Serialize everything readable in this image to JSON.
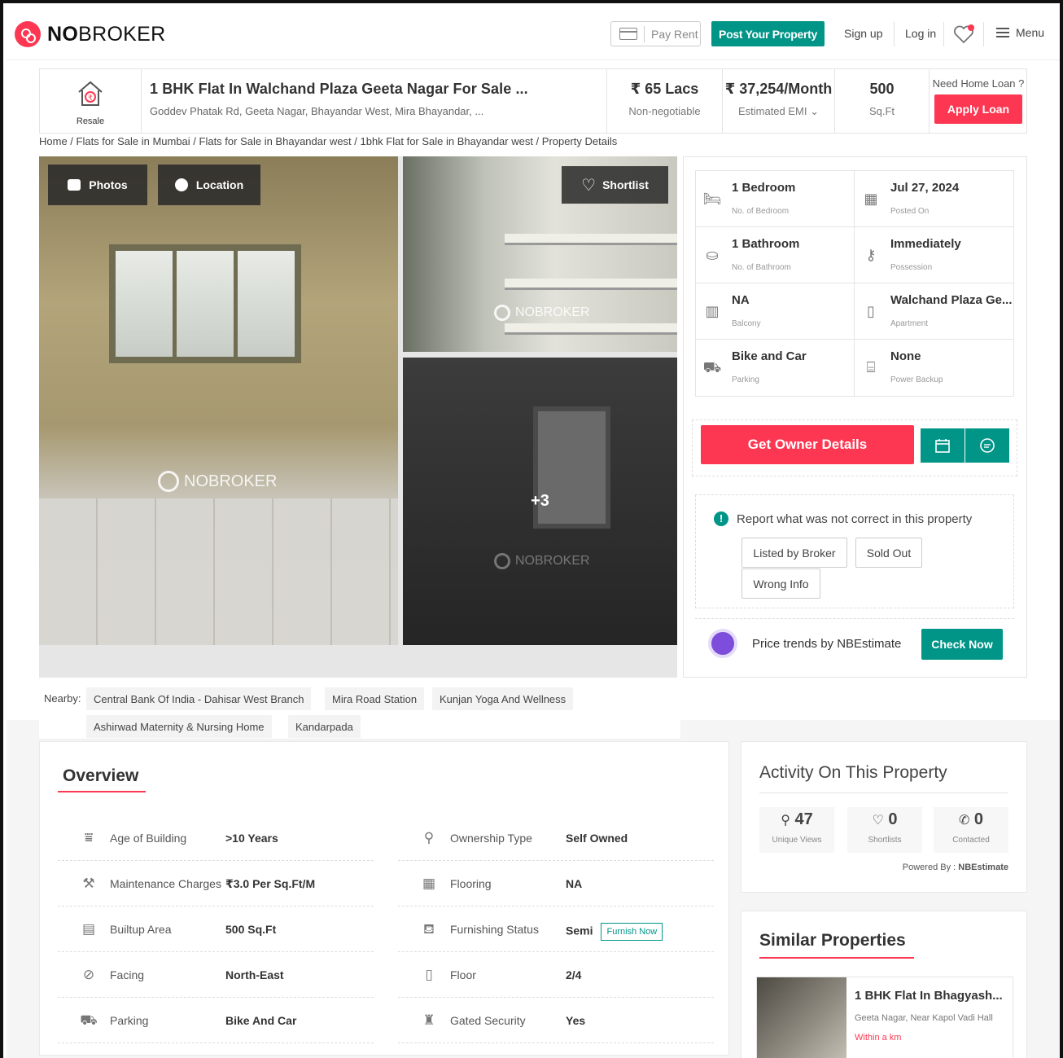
{
  "header": {
    "logo_bold": "NO",
    "logo_light": "BROKER",
    "pay_rent": "Pay Rent",
    "post_property": "Post Your Property",
    "sign_up": "Sign up",
    "log_in": "Log in",
    "menu": "Menu"
  },
  "property": {
    "type_label": "Resale",
    "title": "1 BHK Flat In Walchand Plaza Geeta Nagar For Sale ...",
    "address": "Goddev Phatak Rd, Geeta Nagar, Bhayandar West, Mira Bhayandar, ...",
    "price": "₹ 65 Lacs",
    "price_note": "Non-negotiable",
    "emi": "₹ 37,254/Month",
    "emi_note": "Estimated EMI",
    "area": "500",
    "area_unit": "Sq.Ft",
    "loan_question": "Need Home Loan ?",
    "apply_loan": "Apply Loan"
  },
  "breadcrumb": "Home / Flats for Sale in Mumbai / Flats for Sale in Bhayandar west / 1bhk Flat for Sale in Bhayandar west / Property Details",
  "gallery": {
    "photos": "Photos",
    "location": "Location",
    "shortlist": "Shortlist",
    "more_count": "+3",
    "watermark": "NOBROKER"
  },
  "specs": [
    {
      "value": "1 Bedroom",
      "label": "No. of Bedroom",
      "icon": "bed-icon"
    },
    {
      "value": "Jul 27, 2024",
      "label": "Posted On",
      "icon": "calendar-icon"
    },
    {
      "value": "1 Bathroom",
      "label": "No. of Bathroom",
      "icon": "bathtub-icon"
    },
    {
      "value": "Immediately",
      "label": "Possession",
      "icon": "key-icon"
    },
    {
      "value": "NA",
      "label": "Balcony",
      "icon": "balcony-icon"
    },
    {
      "value": "Walchand Plaza Ge...",
      "label": "Apartment",
      "icon": "building-icon"
    },
    {
      "value": "Bike and Car",
      "label": "Parking",
      "icon": "car-icon"
    },
    {
      "value": "None",
      "label": "Power Backup",
      "icon": "battery-icon"
    }
  ],
  "actions": {
    "get_owner": "Get Owner Details"
  },
  "report": {
    "title": "Report what was not correct in this property",
    "options": [
      "Listed by Broker",
      "Sold Out",
      "Wrong Info"
    ]
  },
  "trends": {
    "text": "Price trends by NBEstimate",
    "button": "Check Now"
  },
  "nearby": {
    "label": "Nearby:",
    "places": [
      "Central Bank Of India - Dahisar West Branch",
      "Mira Road Station",
      "Kunjan Yoga And Wellness",
      "Ashirwad Maternity & Nursing Home",
      "Kandarpada"
    ]
  },
  "overview": {
    "title": "Overview",
    "left": [
      {
        "label": "Age of Building",
        "value": ">10 Years",
        "icon": "cake-icon"
      },
      {
        "label": "Maintenance Charges",
        "value": "₹3.0 Per Sq.Ft/M",
        "icon": "tools-icon"
      },
      {
        "label": "Builtup Area",
        "value": "500 Sq.Ft",
        "icon": "area-icon"
      },
      {
        "label": "Facing",
        "value": "North-East",
        "icon": "compass-icon"
      },
      {
        "label": "Parking",
        "value": "Bike And Car",
        "icon": "car-icon"
      }
    ],
    "right": [
      {
        "label": "Ownership Type",
        "value": "Self Owned",
        "icon": "ownership-icon"
      },
      {
        "label": "Flooring",
        "value": "NA",
        "icon": "flooring-icon"
      },
      {
        "label": "Furnishing Status",
        "value": "Semi",
        "icon": "sofa-icon"
      },
      {
        "label": "Floor",
        "value": "2/4",
        "icon": "floor-icon"
      },
      {
        "label": "Gated Security",
        "value": "Yes",
        "icon": "guard-icon"
      }
    ],
    "furnish_now": "Furnish Now"
  },
  "activity": {
    "title": "Activity On This Property",
    "stats": [
      {
        "value": "47",
        "label": "Unique Views",
        "icon": "person-icon"
      },
      {
        "value": "0",
        "label": "Shortlists",
        "icon": "heart-icon"
      },
      {
        "value": "0",
        "label": "Contacted",
        "icon": "phone-icon"
      }
    ],
    "powered_label": "Powered By :",
    "powered_by": "NBEstimate"
  },
  "similar": {
    "title": "Similar Properties",
    "item_title": "1 BHK Flat In Bhagyash...",
    "item_location": "Geeta Nagar, Near Kapol Vadi Hall",
    "item_distance": "Within a km"
  },
  "colors": {
    "brand_red": "#fd3752",
    "brand_green": "#009587"
  }
}
